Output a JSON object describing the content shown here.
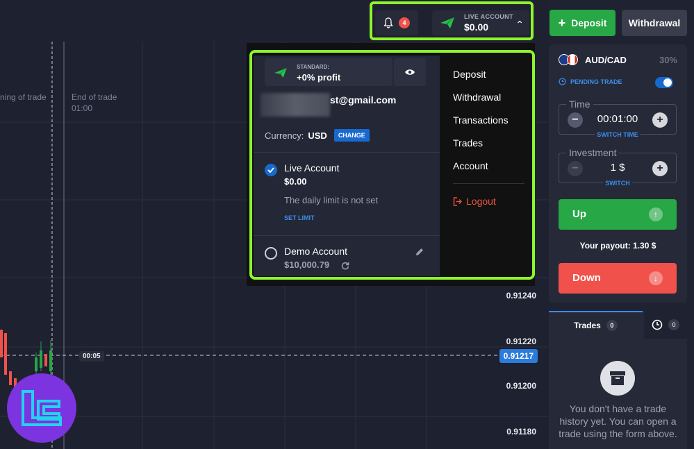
{
  "header": {
    "notifications_count": "4",
    "account_label": "LIVE ACCOUNT",
    "account_balance": "$0.00",
    "deposit_label": "Deposit",
    "withdrawal_label": "Withdrawal"
  },
  "chart": {
    "beginning_label": "ning of trade",
    "end_label": "End of trade",
    "end_time": "01:00",
    "timer": "00:05",
    "current_price": "0.91217",
    "price_ticks": [
      "0.91240",
      "0.91220",
      "0.91200",
      "0.91180"
    ]
  },
  "dropdown": {
    "plan_label": "STANDARD:",
    "plan_value": "+0% profit",
    "email": "st@gmail.com",
    "currency_label": "Currency:",
    "currency_value": "USD",
    "change_label": "CHANGE",
    "live_account": {
      "name": "Live Account",
      "balance": "$0.00",
      "limit_text": "The daily limit is not set",
      "set_limit": "SET LIMIT"
    },
    "demo_account": {
      "name": "Demo Account",
      "balance": "$10,000.79"
    },
    "menu": [
      "Deposit",
      "Withdrawal",
      "Transactions",
      "Trades",
      "Account"
    ],
    "logout": "Logout"
  },
  "trade_panel": {
    "pair": "AUD/CAD",
    "payout_pct": "30%",
    "pending_label": "PENDING TRADE",
    "time_label": "Time",
    "time_value": "00:01:00",
    "time_switch": "SWITCH TIME",
    "investment_label": "Investment",
    "investment_value": "1 $",
    "investment_switch": "SWITCH",
    "up_label": "Up",
    "down_label": "Down",
    "payout_label": "Your payout:",
    "payout_value": "1.30 $"
  },
  "trades_panel": {
    "tab_trades": "Trades",
    "trades_count": "0",
    "history_count": "0",
    "empty_text": "You don't have a trade history yet. You can open a trade using the form above."
  },
  "colors": {
    "accent_green": "#8ef52b",
    "up": "#27a745",
    "down": "#f0524b",
    "blue": "#1769cf"
  }
}
